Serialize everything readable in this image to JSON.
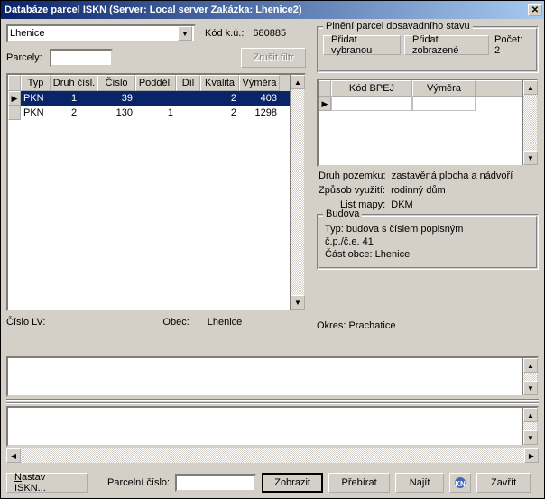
{
  "title": "Databáze parcel ISKN     (Server: Local server  Zakázka: Lhenice2)",
  "combo_value": "Lhenice",
  "kod_ku_label": "Kód k.ú.:",
  "kod_ku_value": "680885",
  "parcely_label": "Parcely:",
  "zrusit_filtr": "Zrušit filtr",
  "pocet_label": "Počet:",
  "pocet_value": "2",
  "plneni": {
    "title": "Plnění parcel dosavadního stavu",
    "pridat_vybranou": "Přidat vybranou",
    "pridat_zobrazene": "Přidat zobrazené"
  },
  "main_grid": {
    "headers": [
      "Typ",
      "Druh čísl.",
      "Číslo",
      "Podděl.",
      "Díl",
      "Kvalita",
      "Výměra"
    ],
    "rows": [
      {
        "marker": "▶",
        "selected": true,
        "cells": [
          "PKN",
          "1",
          "39",
          "",
          "",
          "2",
          "403"
        ]
      },
      {
        "marker": "",
        "selected": false,
        "cells": [
          "PKN",
          "2",
          "130",
          "1",
          "",
          "2",
          "1298"
        ]
      }
    ]
  },
  "right_grid": {
    "headers": [
      "Kód BPEJ",
      "Výměra"
    ]
  },
  "info": {
    "druh_pozemku_l": "Druh pozemku:",
    "druh_pozemku_v": "zastavěná plocha a nádvoří",
    "zpusob_l": "Způsob využití:",
    "zpusob_v": "rodinný dům",
    "list_mapy_l": "List mapy:",
    "list_mapy_v": "DKM"
  },
  "budova": {
    "title": "Budova",
    "typ_l": "Typ:",
    "typ_v": "budova s číslem popisným",
    "cp_l": "č.p./č.e.",
    "cp_v": "41",
    "cast_l": "Část obce:",
    "cast_v": "Lhenice"
  },
  "footer": {
    "cislo_lv_l": "Číslo LV:",
    "obec_l": "Obec:",
    "obec_v": "Lhenice",
    "okres_l": "Okres:",
    "okres_v": "Prachatice"
  },
  "buttons": {
    "nastav": "Nastav ISKN...",
    "parcelni_cislo": "Parcelní číslo:",
    "zobrazit": "Zobrazit",
    "prebirat": "Přebírat",
    "najit": "Najít",
    "zavrit": "Zavřít"
  }
}
